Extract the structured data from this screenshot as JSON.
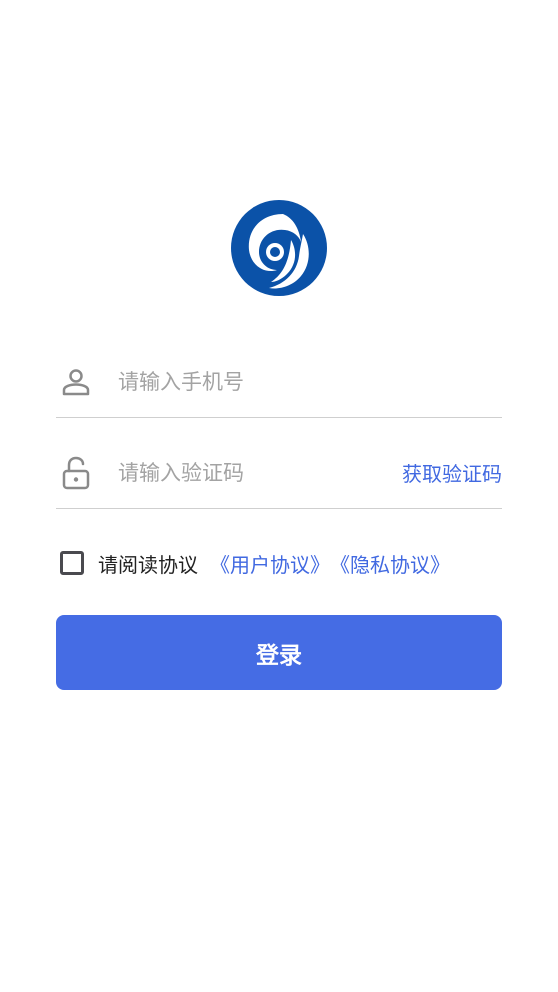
{
  "colors": {
    "accent": "#456ce4",
    "link": "#4169e1",
    "logo_blue": "#0b52a8"
  },
  "logo": {
    "icon": "swirl-logo-icon"
  },
  "phone_field": {
    "icon": "user-icon",
    "placeholder": "请输入手机号",
    "value": ""
  },
  "code_field": {
    "icon": "unlock-icon",
    "placeholder": "请输入验证码",
    "value": "",
    "get_code_label": "获取验证码"
  },
  "agreement": {
    "checked": false,
    "text": "请阅读协议",
    "user_agreement": "《用户协议》",
    "privacy_policy": "《隐私协议》"
  },
  "login": {
    "label": "登录"
  }
}
